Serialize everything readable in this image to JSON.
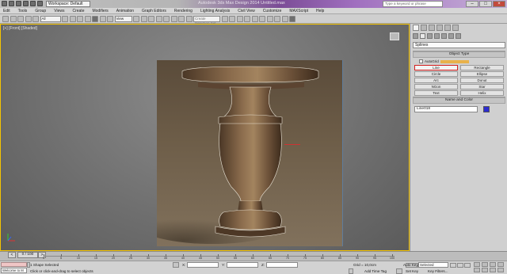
{
  "title_bar": {
    "workspace": "Workspace: Default",
    "app_title": "Autodesk 3ds Max Design 2014   Untitled.max",
    "search_placeholder": "Type a keyword or phrase"
  },
  "menu": [
    "Edit",
    "Tools",
    "Group",
    "Views",
    "Create",
    "Modifiers",
    "Animation",
    "Graph Editors",
    "Rendering",
    "Lighting Analysis",
    "Civil View",
    "Customize",
    "MAXScript",
    "Help"
  ],
  "toolbar": {
    "view_select": "View",
    "selection_set": "Create Selection Set"
  },
  "viewport": {
    "label": "[+] [Front] [Shaded]"
  },
  "command_panel": {
    "category": "Splines",
    "object_type_title": "Object Type",
    "autogrid_label": "AutoGrid",
    "objects": [
      "Line",
      "Rectangle",
      "Circle",
      "Ellipse",
      "Arc",
      "Donut",
      "NGon",
      "Star",
      "Text",
      "Helix",
      "Egg",
      "Section"
    ],
    "name_color_title": "Name and Color",
    "name_value": "Line018",
    "selected_color": "#2c2cd0"
  },
  "timeline": {
    "frame_counter": "0 / 100",
    "ticks": [
      "0",
      "5",
      "10",
      "15",
      "20",
      "25",
      "30",
      "35",
      "40",
      "45",
      "50",
      "55",
      "60",
      "65",
      "70",
      "75",
      "80",
      "85",
      "90",
      "95",
      "100"
    ]
  },
  "status": {
    "maxscript": "Welcome to M",
    "selection": "1 Shape Selected",
    "prompt": "Click or click-and-drag to select objects",
    "grid": "Grid = 10,0cm",
    "add_time_tag": "Add Time Tag",
    "auto_key": "Auto Key",
    "selected_dropdown": "Selected",
    "set_key": "Set Key",
    "key_filters": "Key Filters..."
  }
}
